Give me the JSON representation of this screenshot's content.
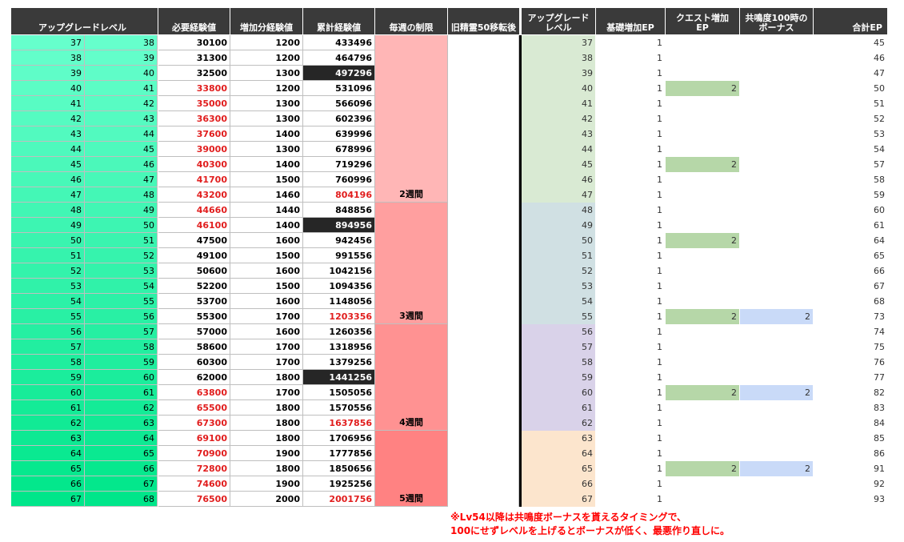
{
  "headers": {
    "upgrade_level": "アップグレードレベル",
    "required_exp": "必要経験値",
    "added_exp": "増加分経験値",
    "cumulative_exp": "累計経験値",
    "weekly_limit": "毎週の制限",
    "old_spirit": "旧精霊50移転後",
    "upgrade_level2": "アップグレード\nレベル",
    "base_ep": "基礎増加EP",
    "quest_ep": "クエスト増加\nEP",
    "resonance_bonus": "共鳴度100時の\nボーナス",
    "total_ep": "合計EP"
  },
  "left_rows": [
    {
      "from": "37",
      "to": "38",
      "req": "30100",
      "add": "1200",
      "cum": "433496",
      "req_red": false,
      "cum_style": ""
    },
    {
      "from": "38",
      "to": "39",
      "req": "31300",
      "add": "1200",
      "cum": "464796",
      "req_red": false,
      "cum_style": ""
    },
    {
      "from": "39",
      "to": "40",
      "req": "32500",
      "add": "1300",
      "cum": "497296",
      "req_red": false,
      "cum_style": "hl"
    },
    {
      "from": "40",
      "to": "41",
      "req": "33800",
      "add": "1200",
      "cum": "531096",
      "req_red": true,
      "cum_style": ""
    },
    {
      "from": "41",
      "to": "42",
      "req": "35000",
      "add": "1300",
      "cum": "566096",
      "req_red": true,
      "cum_style": ""
    },
    {
      "from": "42",
      "to": "43",
      "req": "36300",
      "add": "1300",
      "cum": "602396",
      "req_red": true,
      "cum_style": ""
    },
    {
      "from": "43",
      "to": "44",
      "req": "37600",
      "add": "1400",
      "cum": "639996",
      "req_red": true,
      "cum_style": ""
    },
    {
      "from": "44",
      "to": "45",
      "req": "39000",
      "add": "1300",
      "cum": "678996",
      "req_red": true,
      "cum_style": ""
    },
    {
      "from": "45",
      "to": "46",
      "req": "40300",
      "add": "1400",
      "cum": "719296",
      "req_red": true,
      "cum_style": ""
    },
    {
      "from": "46",
      "to": "47",
      "req": "41700",
      "add": "1500",
      "cum": "760996",
      "req_red": true,
      "cum_style": ""
    },
    {
      "from": "47",
      "to": "48",
      "req": "43200",
      "add": "1460",
      "cum": "804196",
      "req_red": true,
      "cum_style": "red"
    },
    {
      "from": "48",
      "to": "49",
      "req": "44660",
      "add": "1440",
      "cum": "848856",
      "req_red": true,
      "cum_style": ""
    },
    {
      "from": "49",
      "to": "50",
      "req": "46100",
      "add": "1400",
      "cum": "894956",
      "req_red": true,
      "cum_style": "hl"
    },
    {
      "from": "50",
      "to": "51",
      "req": "47500",
      "add": "1600",
      "cum": "942456",
      "req_red": false,
      "cum_style": ""
    },
    {
      "from": "51",
      "to": "52",
      "req": "49100",
      "add": "1500",
      "cum": "991556",
      "req_red": false,
      "cum_style": ""
    },
    {
      "from": "52",
      "to": "53",
      "req": "50600",
      "add": "1600",
      "cum": "1042156",
      "req_red": false,
      "cum_style": ""
    },
    {
      "from": "53",
      "to": "54",
      "req": "52200",
      "add": "1500",
      "cum": "1094356",
      "req_red": false,
      "cum_style": ""
    },
    {
      "from": "54",
      "to": "55",
      "req": "53700",
      "add": "1600",
      "cum": "1148056",
      "req_red": false,
      "cum_style": ""
    },
    {
      "from": "55",
      "to": "56",
      "req": "55300",
      "add": "1700",
      "cum": "1203356",
      "req_red": false,
      "cum_style": "red"
    },
    {
      "from": "56",
      "to": "57",
      "req": "57000",
      "add": "1600",
      "cum": "1260356",
      "req_red": false,
      "cum_style": ""
    },
    {
      "from": "57",
      "to": "58",
      "req": "58600",
      "add": "1700",
      "cum": "1318956",
      "req_red": false,
      "cum_style": ""
    },
    {
      "from": "58",
      "to": "59",
      "req": "60300",
      "add": "1700",
      "cum": "1379256",
      "req_red": false,
      "cum_style": ""
    },
    {
      "from": "59",
      "to": "60",
      "req": "62000",
      "add": "1800",
      "cum": "1441256",
      "req_red": false,
      "cum_style": "hl"
    },
    {
      "from": "60",
      "to": "61",
      "req": "63800",
      "add": "1700",
      "cum": "1505056",
      "req_red": true,
      "cum_style": ""
    },
    {
      "from": "61",
      "to": "62",
      "req": "65500",
      "add": "1800",
      "cum": "1570556",
      "req_red": true,
      "cum_style": ""
    },
    {
      "from": "62",
      "to": "63",
      "req": "67300",
      "add": "1800",
      "cum": "1637856",
      "req_red": true,
      "cum_style": "red"
    },
    {
      "from": "63",
      "to": "64",
      "req": "69100",
      "add": "1800",
      "cum": "1706956",
      "req_red": true,
      "cum_style": ""
    },
    {
      "from": "64",
      "to": "65",
      "req": "70900",
      "add": "1900",
      "cum": "1777856",
      "req_red": true,
      "cum_style": ""
    },
    {
      "from": "65",
      "to": "66",
      "req": "72800",
      "add": "1800",
      "cum": "1850656",
      "req_red": true,
      "cum_style": ""
    },
    {
      "from": "66",
      "to": "67",
      "req": "74600",
      "add": "1900",
      "cum": "1925256",
      "req_red": true,
      "cum_style": ""
    },
    {
      "from": "67",
      "to": "68",
      "req": "76500",
      "add": "2000",
      "cum": "2001756",
      "req_red": true,
      "cum_style": "red"
    }
  ],
  "weekly_segments": [
    {
      "start": 0,
      "count": 11,
      "label": "2週間",
      "color": "#ffb6b6"
    },
    {
      "start": 11,
      "count": 8,
      "label": "3週間",
      "color": "#ff9f9f"
    },
    {
      "start": 19,
      "count": 7,
      "label": "4週間",
      "color": "#ff9292"
    },
    {
      "start": 26,
      "count": 5,
      "label": "5週間",
      "color": "#ff8282"
    }
  ],
  "right_rows": [
    {
      "lv": "37",
      "base": "1",
      "quest": "",
      "bonus": "",
      "total": "45"
    },
    {
      "lv": "38",
      "base": "1",
      "quest": "",
      "bonus": "",
      "total": "46"
    },
    {
      "lv": "39",
      "base": "1",
      "quest": "",
      "bonus": "",
      "total": "47"
    },
    {
      "lv": "40",
      "base": "1",
      "quest": "2",
      "bonus": "",
      "total": "50"
    },
    {
      "lv": "41",
      "base": "1",
      "quest": "",
      "bonus": "",
      "total": "51"
    },
    {
      "lv": "42",
      "base": "1",
      "quest": "",
      "bonus": "",
      "total": "52"
    },
    {
      "lv": "43",
      "base": "1",
      "quest": "",
      "bonus": "",
      "total": "53"
    },
    {
      "lv": "44",
      "base": "1",
      "quest": "",
      "bonus": "",
      "total": "54"
    },
    {
      "lv": "45",
      "base": "1",
      "quest": "2",
      "bonus": "",
      "total": "57"
    },
    {
      "lv": "46",
      "base": "1",
      "quest": "",
      "bonus": "",
      "total": "58"
    },
    {
      "lv": "47",
      "base": "1",
      "quest": "",
      "bonus": "",
      "total": "59"
    },
    {
      "lv": "48",
      "base": "1",
      "quest": "",
      "bonus": "",
      "total": "60"
    },
    {
      "lv": "49",
      "base": "1",
      "quest": "",
      "bonus": "",
      "total": "61"
    },
    {
      "lv": "50",
      "base": "1",
      "quest": "2",
      "bonus": "",
      "total": "64"
    },
    {
      "lv": "51",
      "base": "1",
      "quest": "",
      "bonus": "",
      "total": "65"
    },
    {
      "lv": "52",
      "base": "1",
      "quest": "",
      "bonus": "",
      "total": "66"
    },
    {
      "lv": "53",
      "base": "1",
      "quest": "",
      "bonus": "",
      "total": "67"
    },
    {
      "lv": "54",
      "base": "1",
      "quest": "",
      "bonus": "",
      "total": "68"
    },
    {
      "lv": "55",
      "base": "1",
      "quest": "2",
      "bonus": "2",
      "total": "73"
    },
    {
      "lv": "56",
      "base": "1",
      "quest": "",
      "bonus": "",
      "total": "74"
    },
    {
      "lv": "57",
      "base": "1",
      "quest": "",
      "bonus": "",
      "total": "75"
    },
    {
      "lv": "58",
      "base": "1",
      "quest": "",
      "bonus": "",
      "total": "76"
    },
    {
      "lv": "59",
      "base": "1",
      "quest": "",
      "bonus": "",
      "total": "77"
    },
    {
      "lv": "60",
      "base": "1",
      "quest": "2",
      "bonus": "2",
      "total": "82"
    },
    {
      "lv": "61",
      "base": "1",
      "quest": "",
      "bonus": "",
      "total": "83"
    },
    {
      "lv": "62",
      "base": "1",
      "quest": "",
      "bonus": "",
      "total": "84"
    },
    {
      "lv": "63",
      "base": "1",
      "quest": "",
      "bonus": "",
      "total": "85"
    },
    {
      "lv": "64",
      "base": "1",
      "quest": "",
      "bonus": "",
      "total": "86"
    },
    {
      "lv": "65",
      "base": "1",
      "quest": "2",
      "bonus": "2",
      "total": "91"
    },
    {
      "lv": "66",
      "base": "1",
      "quest": "",
      "bonus": "",
      "total": "92"
    },
    {
      "lv": "67",
      "base": "1",
      "quest": "",
      "bonus": "",
      "total": "93"
    }
  ],
  "level_group_colors": [
    {
      "start": 0,
      "count": 11,
      "color": "#d9ead3"
    },
    {
      "start": 11,
      "count": 8,
      "color": "#d0e0e3"
    },
    {
      "start": 19,
      "count": 7,
      "color": "#d9d2e9"
    },
    {
      "start": 26,
      "count": 5,
      "color": "#fce5cd"
    }
  ],
  "colors": {
    "header_bg": "#3a3a3a",
    "level_gradient_top": "#66ffcc",
    "level_gradient_bottom": "#00e68a",
    "quest_fill": "#b6d7a8",
    "bonus_fill": "#c9daf8",
    "red_text": "#e11d1d"
  },
  "note": "※Lv54以降は共鳴度ボーナスを貰えるタイミングで、\n100にせずレベルを上げるとボーナスが低く、最悪作り直しに。"
}
